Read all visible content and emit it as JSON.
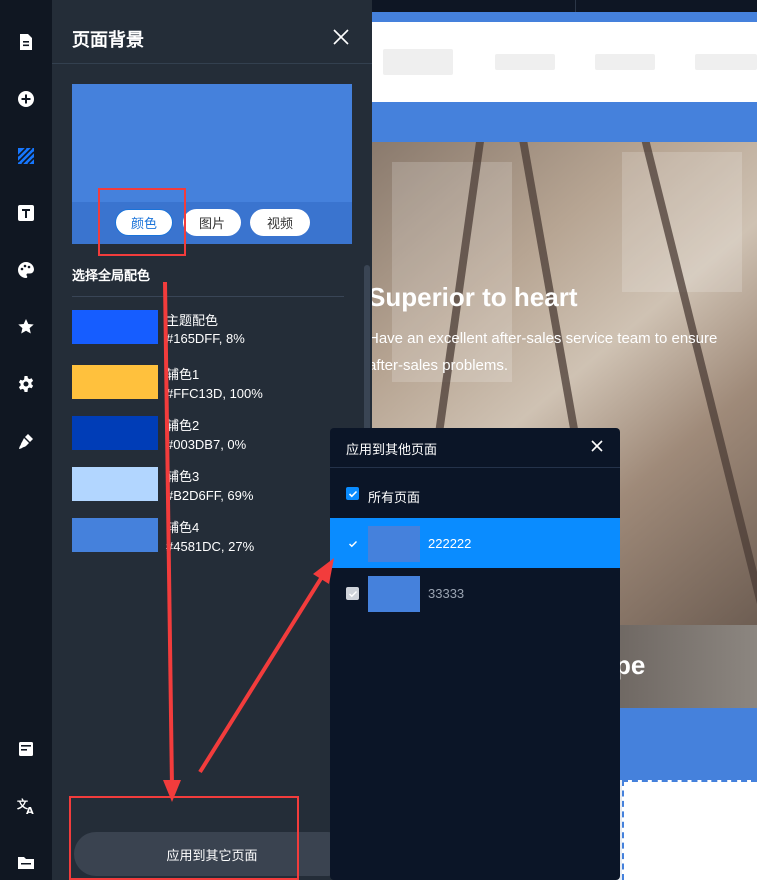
{
  "rail": {
    "icons_top": [
      "page-icon",
      "add-circle-icon",
      "background-icon",
      "text-icon",
      "palette-icon",
      "star-icon",
      "gear-icon",
      "brush-icon"
    ],
    "icons_bottom": [
      "form-icon",
      "translate-icon",
      "folder-icon"
    ],
    "active_icon": "background-icon"
  },
  "panel": {
    "title": "页面背景",
    "tabs": [
      "颜色",
      "图片",
      "视频"
    ],
    "active_tab": "颜色",
    "section_title": "选择全局配色",
    "colors": [
      {
        "name": "主题配色",
        "value": "#165DFF, 8%",
        "hex": "#165DFF"
      },
      {
        "name": "辅色1",
        "value": "#FFC13D, 100%",
        "hex": "#FFC13D"
      },
      {
        "name": "辅色2",
        "value": "#003DB7, 0%",
        "hex": "#003DB7"
      },
      {
        "name": "辅色3",
        "value": "#B2D6FF, 69%",
        "hex": "#B2D6FF"
      },
      {
        "name": "辅色4",
        "value": "#4581DC, 27%",
        "hex": "#4581DC"
      }
    ],
    "preview_color": "#4581DC",
    "apply_button": "应用到其它页面"
  },
  "preview": {
    "hero_title": "Superior to heart",
    "hero_line1": "Have an excellent after-sales service team to ensure",
    "hero_line2": "after-sales problems.",
    "strip_text": "pe"
  },
  "popup": {
    "title": "应用到其他页面",
    "all_pages_label": "所有页面",
    "all_pages_checked": true,
    "pages": [
      {
        "label": "222222",
        "checked": true,
        "selected": true
      },
      {
        "label": "33333",
        "checked": true,
        "selected": false
      }
    ]
  },
  "colors": {
    "accent": "#0A8CFF",
    "annotation": "#F23C3C",
    "panel_bg": "#242D38"
  }
}
